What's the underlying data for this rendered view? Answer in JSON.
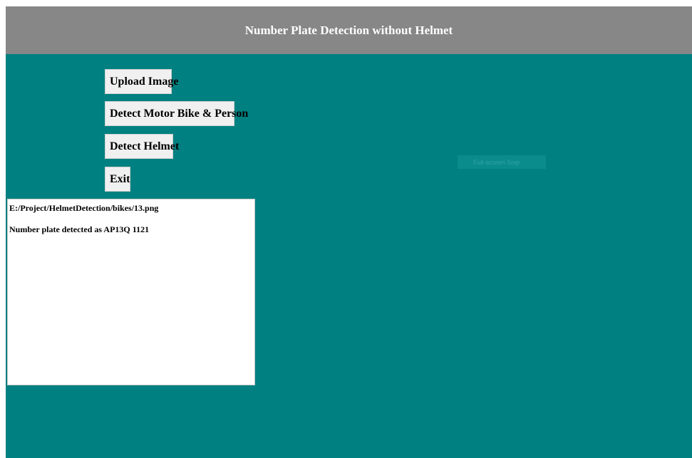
{
  "window": {
    "title": "Number Plate Detection without Helmet"
  },
  "buttons": {
    "upload_label": "Upload Image",
    "detect_bike_label": "Detect Motor Bike & Person",
    "detect_helmet_label": "Detect Helmet",
    "exit_label": "Exit"
  },
  "output": {
    "line1": "E:/Project/HelmetDetection/bikes/13.png",
    "line2": "Number plate detected as AP13Q 1121"
  },
  "overlay": {
    "tooltip_text": "Full-screen Snip"
  },
  "colors": {
    "background": "#008080",
    "title_bar": "#878787",
    "button_bg": "#f0f0f0"
  }
}
